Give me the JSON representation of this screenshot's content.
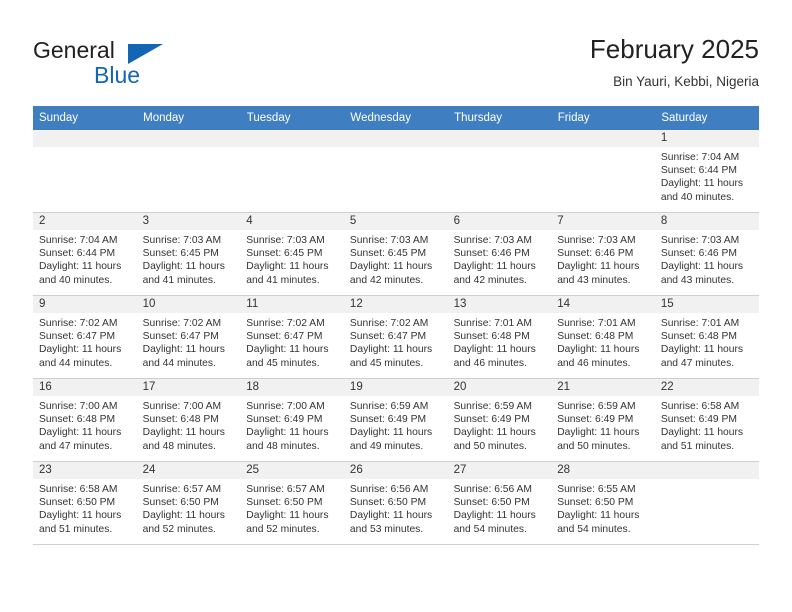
{
  "brand": {
    "word1": "General",
    "word2": "Blue",
    "accent_color": "#1266b5",
    "triangle_icon": "brand-triangle-icon"
  },
  "header": {
    "title": "February 2025",
    "location": "Bin Yauri, Kebbi, Nigeria"
  },
  "calendar": {
    "header_bg": "#3f7fc1",
    "daynum_bg": "#f1f1f1",
    "weekday_names": [
      "Sunday",
      "Monday",
      "Tuesday",
      "Wednesday",
      "Thursday",
      "Friday",
      "Saturday"
    ],
    "weeks": [
      [
        {
          "empty": true
        },
        {
          "empty": true
        },
        {
          "empty": true
        },
        {
          "empty": true
        },
        {
          "empty": true
        },
        {
          "empty": true
        },
        {
          "day": "1",
          "sunrise": "Sunrise: 7:04 AM",
          "sunset": "Sunset: 6:44 PM",
          "daylight": "Daylight: 11 hours and 40 minutes."
        }
      ],
      [
        {
          "day": "2",
          "sunrise": "Sunrise: 7:04 AM",
          "sunset": "Sunset: 6:44 PM",
          "daylight": "Daylight: 11 hours and 40 minutes."
        },
        {
          "day": "3",
          "sunrise": "Sunrise: 7:03 AM",
          "sunset": "Sunset: 6:45 PM",
          "daylight": "Daylight: 11 hours and 41 minutes."
        },
        {
          "day": "4",
          "sunrise": "Sunrise: 7:03 AM",
          "sunset": "Sunset: 6:45 PM",
          "daylight": "Daylight: 11 hours and 41 minutes."
        },
        {
          "day": "5",
          "sunrise": "Sunrise: 7:03 AM",
          "sunset": "Sunset: 6:45 PM",
          "daylight": "Daylight: 11 hours and 42 minutes."
        },
        {
          "day": "6",
          "sunrise": "Sunrise: 7:03 AM",
          "sunset": "Sunset: 6:46 PM",
          "daylight": "Daylight: 11 hours and 42 minutes."
        },
        {
          "day": "7",
          "sunrise": "Sunrise: 7:03 AM",
          "sunset": "Sunset: 6:46 PM",
          "daylight": "Daylight: 11 hours and 43 minutes."
        },
        {
          "day": "8",
          "sunrise": "Sunrise: 7:03 AM",
          "sunset": "Sunset: 6:46 PM",
          "daylight": "Daylight: 11 hours and 43 minutes."
        }
      ],
      [
        {
          "day": "9",
          "sunrise": "Sunrise: 7:02 AM",
          "sunset": "Sunset: 6:47 PM",
          "daylight": "Daylight: 11 hours and 44 minutes."
        },
        {
          "day": "10",
          "sunrise": "Sunrise: 7:02 AM",
          "sunset": "Sunset: 6:47 PM",
          "daylight": "Daylight: 11 hours and 44 minutes."
        },
        {
          "day": "11",
          "sunrise": "Sunrise: 7:02 AM",
          "sunset": "Sunset: 6:47 PM",
          "daylight": "Daylight: 11 hours and 45 minutes."
        },
        {
          "day": "12",
          "sunrise": "Sunrise: 7:02 AM",
          "sunset": "Sunset: 6:47 PM",
          "daylight": "Daylight: 11 hours and 45 minutes."
        },
        {
          "day": "13",
          "sunrise": "Sunrise: 7:01 AM",
          "sunset": "Sunset: 6:48 PM",
          "daylight": "Daylight: 11 hours and 46 minutes."
        },
        {
          "day": "14",
          "sunrise": "Sunrise: 7:01 AM",
          "sunset": "Sunset: 6:48 PM",
          "daylight": "Daylight: 11 hours and 46 minutes."
        },
        {
          "day": "15",
          "sunrise": "Sunrise: 7:01 AM",
          "sunset": "Sunset: 6:48 PM",
          "daylight": "Daylight: 11 hours and 47 minutes."
        }
      ],
      [
        {
          "day": "16",
          "sunrise": "Sunrise: 7:00 AM",
          "sunset": "Sunset: 6:48 PM",
          "daylight": "Daylight: 11 hours and 47 minutes."
        },
        {
          "day": "17",
          "sunrise": "Sunrise: 7:00 AM",
          "sunset": "Sunset: 6:48 PM",
          "daylight": "Daylight: 11 hours and 48 minutes."
        },
        {
          "day": "18",
          "sunrise": "Sunrise: 7:00 AM",
          "sunset": "Sunset: 6:49 PM",
          "daylight": "Daylight: 11 hours and 48 minutes."
        },
        {
          "day": "19",
          "sunrise": "Sunrise: 6:59 AM",
          "sunset": "Sunset: 6:49 PM",
          "daylight": "Daylight: 11 hours and 49 minutes."
        },
        {
          "day": "20",
          "sunrise": "Sunrise: 6:59 AM",
          "sunset": "Sunset: 6:49 PM",
          "daylight": "Daylight: 11 hours and 50 minutes."
        },
        {
          "day": "21",
          "sunrise": "Sunrise: 6:59 AM",
          "sunset": "Sunset: 6:49 PM",
          "daylight": "Daylight: 11 hours and 50 minutes."
        },
        {
          "day": "22",
          "sunrise": "Sunrise: 6:58 AM",
          "sunset": "Sunset: 6:49 PM",
          "daylight": "Daylight: 11 hours and 51 minutes."
        }
      ],
      [
        {
          "day": "23",
          "sunrise": "Sunrise: 6:58 AM",
          "sunset": "Sunset: 6:50 PM",
          "daylight": "Daylight: 11 hours and 51 minutes."
        },
        {
          "day": "24",
          "sunrise": "Sunrise: 6:57 AM",
          "sunset": "Sunset: 6:50 PM",
          "daylight": "Daylight: 11 hours and 52 minutes."
        },
        {
          "day": "25",
          "sunrise": "Sunrise: 6:57 AM",
          "sunset": "Sunset: 6:50 PM",
          "daylight": "Daylight: 11 hours and 52 minutes."
        },
        {
          "day": "26",
          "sunrise": "Sunrise: 6:56 AM",
          "sunset": "Sunset: 6:50 PM",
          "daylight": "Daylight: 11 hours and 53 minutes."
        },
        {
          "day": "27",
          "sunrise": "Sunrise: 6:56 AM",
          "sunset": "Sunset: 6:50 PM",
          "daylight": "Daylight: 11 hours and 54 minutes."
        },
        {
          "day": "28",
          "sunrise": "Sunrise: 6:55 AM",
          "sunset": "Sunset: 6:50 PM",
          "daylight": "Daylight: 11 hours and 54 minutes."
        },
        {
          "empty": true
        }
      ]
    ]
  }
}
